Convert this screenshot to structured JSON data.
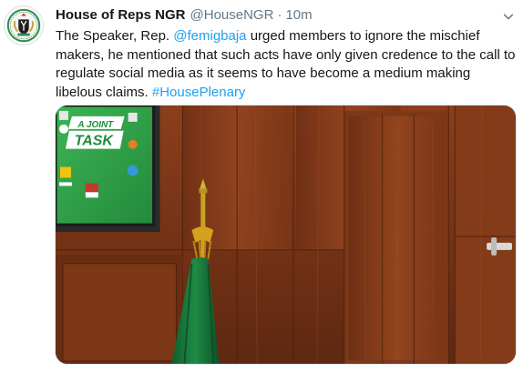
{
  "tweet": {
    "display_name": "House of Reps NGR",
    "handle": "@HouseNGR",
    "separator": "·",
    "time": "10m",
    "text_before": "The Speaker, Rep. ",
    "mention": "@femigbaja",
    "text_after": " urged members to ignore the mischief makers, he mentioned that such acts have only given credence to the call to regulate social media as it seems to have become a medium making libelous claims. ",
    "hashtag": "#HousePlenary"
  },
  "media": {
    "board_line_1": "A JOINT",
    "board_line_2": "TASK"
  },
  "icons": {
    "avatar": "coat-of-arms-icon",
    "menu": "chevron-down-icon"
  },
  "colors": {
    "link": "#1da1f2",
    "muted": "#657786",
    "text": "#14171a",
    "board_green": "#2fa04a",
    "wood": "#8a3f1c"
  }
}
